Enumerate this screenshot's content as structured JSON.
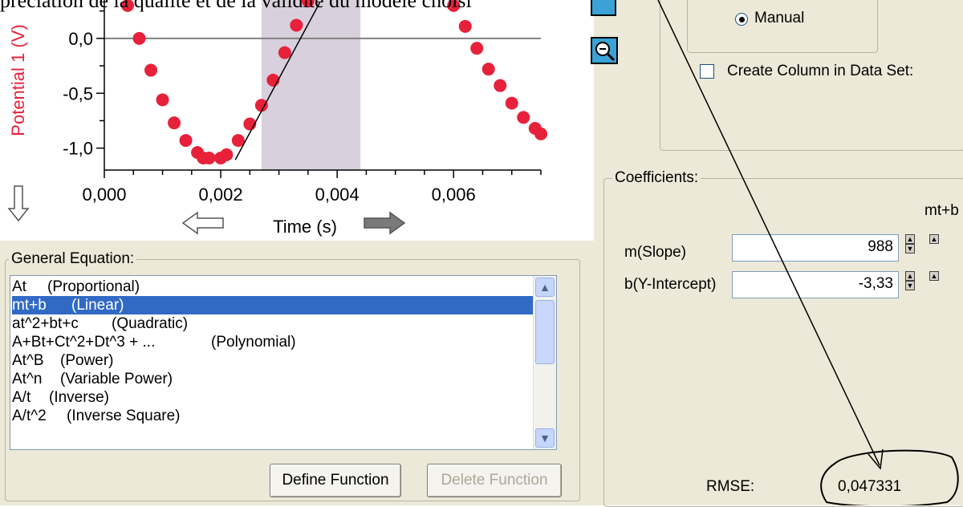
{
  "caption": "préciation de la qualité et de la validité du modèle choisi",
  "chart_data": {
    "type": "scatter",
    "title": "",
    "xlabel": "Time (s)",
    "ylabel": "Potential 1 (V)",
    "xlim": [
      0.0,
      0.0075
    ],
    "ylim": [
      -1.2,
      0.35
    ],
    "x_ticks": [
      "0,000",
      "0,002",
      "0,004",
      "0,006"
    ],
    "y_ticks": [
      "0,0",
      "-0,5",
      "-1,0"
    ],
    "highlight_range": [
      0.0027,
      0.0044
    ],
    "series": [
      {
        "points": [
          [
            0.0004,
            0.3
          ],
          [
            0.0006,
            0.0
          ],
          [
            0.0008,
            -0.29
          ],
          [
            0.001,
            -0.56
          ],
          [
            0.0012,
            -0.77
          ],
          [
            0.0014,
            -0.93
          ],
          [
            0.0016,
            -1.04
          ],
          [
            0.0017,
            -1.09
          ],
          [
            0.0018,
            -1.09
          ],
          [
            0.002,
            -1.09
          ],
          [
            0.0021,
            -1.06
          ],
          [
            0.0023,
            -0.93
          ],
          [
            0.0025,
            -0.78
          ],
          [
            0.0027,
            -0.61
          ],
          [
            0.0029,
            -0.38
          ],
          [
            0.0031,
            -0.13
          ],
          [
            0.0033,
            0.12
          ],
          [
            0.0035,
            0.34
          ],
          [
            0.006,
            0.3
          ],
          [
            0.0062,
            0.11
          ],
          [
            0.0064,
            -0.09
          ],
          [
            0.0066,
            -0.28
          ],
          [
            0.0068,
            -0.43
          ],
          [
            0.007,
            -0.59
          ],
          [
            0.0072,
            -0.72
          ],
          [
            0.0074,
            -0.82
          ],
          [
            0.0075,
            -0.87
          ]
        ]
      }
    ],
    "fit_line": {
      "m": 988,
      "b": -3.33,
      "x_range": [
        0.00225,
        0.0037
      ]
    }
  },
  "colors": {
    "points": "#e8213a",
    "highlight": "#d8d0dc",
    "selected": "#316ac5",
    "panel": "#ece9d8"
  },
  "nav": {
    "down_arrow_icon": "down-arrow-icon",
    "left_arrow_icon": "left-arrow-icon",
    "right_arrow_icon": "right-arrow-icon"
  },
  "general_equation": {
    "legend": "General Equation:",
    "items": [
      {
        "formula": "At",
        "name": "(Proportional)"
      },
      {
        "formula": "mt+b",
        "name": "(Linear)"
      },
      {
        "formula": "at^2+bt+c",
        "name": "(Quadratic)"
      },
      {
        "formula": "A+Bt+Ct^2+Dt^3 + ...",
        "name": "(Polynomial)"
      },
      {
        "formula": "At^B",
        "name": "(Power)"
      },
      {
        "formula": "At^n",
        "name": "(Variable Power)"
      },
      {
        "formula": "A/t",
        "name": "(Inverse)"
      },
      {
        "formula": "A/t^2",
        "name": "(Inverse Square)"
      }
    ],
    "selected_index": 1,
    "define_button": "Define Function",
    "delete_button": "Delete Function"
  },
  "options": {
    "manual_label": "Manual",
    "create_column_label": "Create Column in Data Set:"
  },
  "coefficients": {
    "legend": "Coefficients:",
    "equation": "mt+b",
    "rows": [
      {
        "label": "m(Slope)",
        "value": "988"
      },
      {
        "label": "b(Y-Intercept)",
        "value": "-3,33"
      }
    ],
    "rmse_label": "RMSE:",
    "rmse_value": "0,047331"
  }
}
